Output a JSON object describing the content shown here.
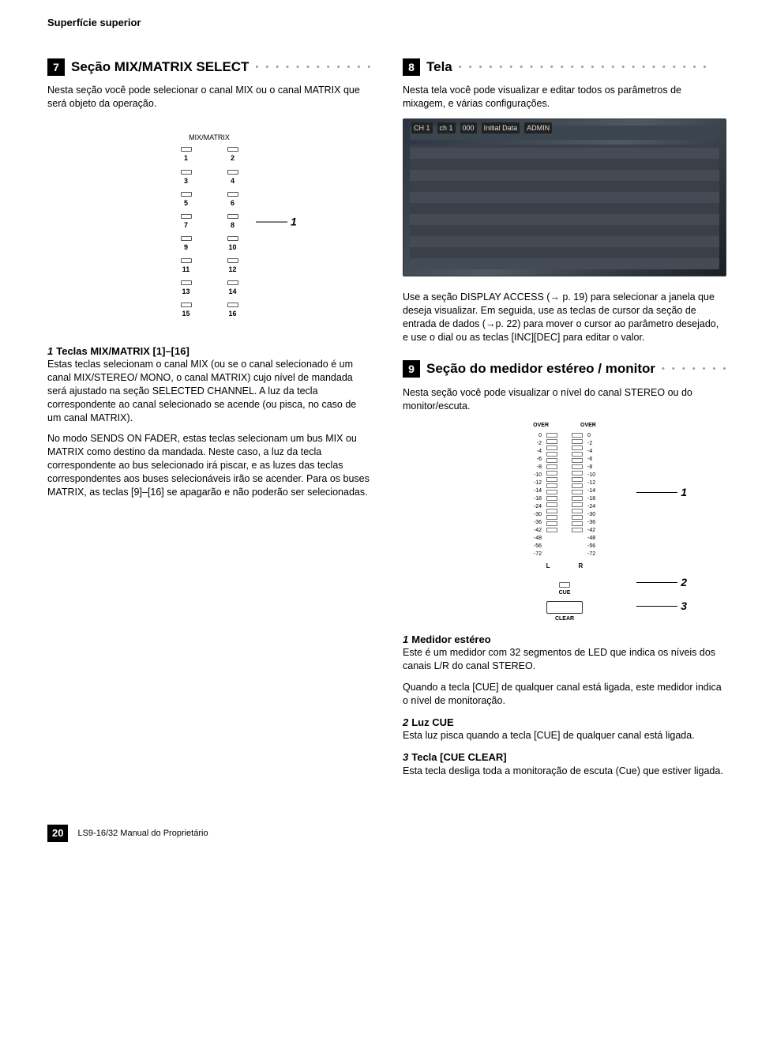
{
  "page": {
    "top_header": "Superfície superior",
    "number": "20",
    "manual": "LS9-16/32  Manual do Proprietário"
  },
  "sec7": {
    "num": "7",
    "title": "Seção MIX/MATRIX SELECT",
    "intro": "Nesta seção você pode selecionar o canal MIX ou o canal MATRIX que será objeto da operação.",
    "panel_title": "MIX/MATRIX",
    "buttons": [
      "1",
      "2",
      "3",
      "4",
      "5",
      "6",
      "7",
      "8",
      "9",
      "10",
      "11",
      "12",
      "13",
      "14",
      "15",
      "16"
    ],
    "callout": "1",
    "item1_label": "Teclas MIX/MATRIX [1]–[16]",
    "item1_num": "1",
    "item1_p1": "Estas teclas selecionam o canal MIX (ou se o canal selecionado é um canal MIX/STEREO/ MONO, o canal MATRIX) cujo nível de mandada será ajustado na seção SELECTED CHANNEL. A luz da tecla correspondente ao canal selecionado se acende (ou pisca, no caso de um canal MATRIX).",
    "item1_p2": "No modo SENDS ON FADER, estas teclas selecionam  um bus MIX ou MATRIX como destino da mandada. Neste caso, a luz da tecla correspondente ao bus selecionado irá piscar, e as luzes das teclas correspondentes aos buses selecionáveis irão se acender. Para os buses MATRIX, as teclas [9]–[16] se apagarão e não poderão ser selecionadas."
  },
  "sec8": {
    "num": "8",
    "title": "Tela",
    "intro": "Nesta tela você pode visualizar e editar todos os parâmetros de mixagem, e várias configurações.",
    "screen_badges": [
      "CH 1",
      "ch 1",
      "000",
      "Initial Data",
      "ADMIN"
    ],
    "para": "Use a seção DISPLAY ACCESS (→ p. 19) para selecionar a janela que deseja visualizar. Em seguida, use as teclas de cursor da seção de entrada de dados (→p. 22) para mover o cursor ao parâmetro desejado, e use o dial ou as teclas [INC][DEC] para editar o valor."
  },
  "sec9": {
    "num": "9",
    "title": "Seção do medidor estéreo / monitor",
    "intro": "Nesta seção você pode visualizar o nível do canal STEREO ou do monitor/escuta.",
    "meter": {
      "over": "OVER",
      "scale": [
        "0",
        "-2",
        "-4",
        "-6",
        "-8",
        "-10",
        "-12",
        "-14",
        "-18",
        "-24",
        "-30",
        "-36",
        "-42",
        "-48",
        "-56",
        "-72"
      ],
      "L": "L",
      "R": "R",
      "cue": "CUE",
      "clear": "CLEAR"
    },
    "callouts": {
      "c1": "1",
      "c2": "2",
      "c3": "3"
    },
    "item1_num": "1",
    "item1_label": "Medidor estéreo",
    "item1_p1": "Este é um medidor com 32 segmentos de LED que indica os níveis dos canais L/R do canal STEREO.",
    "item1_p2": "Quando a tecla [CUE] de qualquer canal está ligada, este medidor indica o nível de monitoração.",
    "item2_num": "2",
    "item2_label": "Luz CUE",
    "item2_p": "Esta luz pisca quando a tecla [CUE] de qualquer canal está ligada.",
    "item3_num": "3",
    "item3_label": "Tecla [CUE CLEAR]",
    "item3_p": "Esta tecla desliga toda a monitoração de escuta (Cue) que estiver ligada."
  },
  "dots": "• • • • • • • • • • • • • • • • • • • • • • • • •"
}
